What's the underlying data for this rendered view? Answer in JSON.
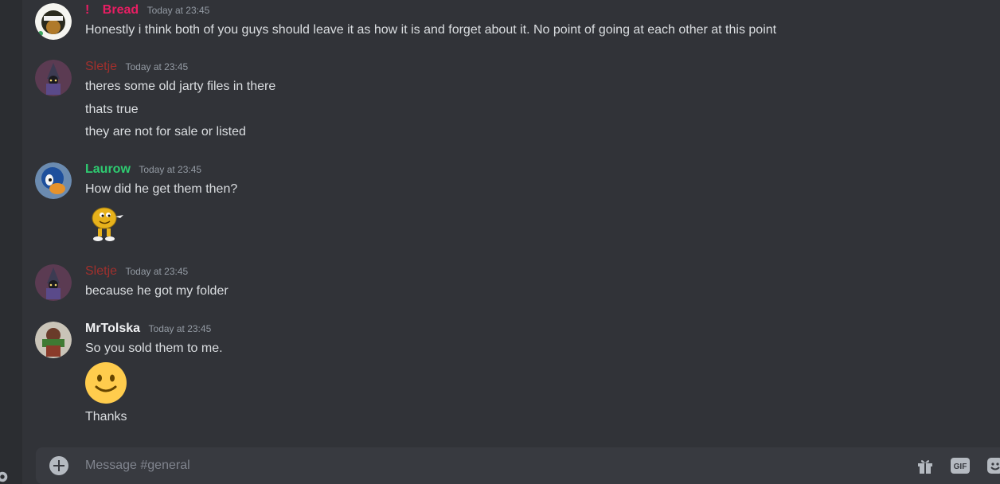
{
  "channel": {
    "message_placeholder": "Message #general"
  },
  "messages": [
    {
      "author_prefix": "!",
      "author": "Bread",
      "author_color": "#e91e63",
      "timestamp": "Today at 23:45",
      "lines": [
        "Honestly i think both of you guys should leave it as how it is and forget about it. No point of going at each other at this point"
      ]
    },
    {
      "author": "Sletje",
      "author_color": "#a0302d",
      "timestamp": "Today at 23:45",
      "lines": [
        "theres some old jarty files in there",
        "thats true",
        "they are not for sale or listed"
      ]
    },
    {
      "author": "Laurow",
      "author_color": "#2ecc71",
      "timestamp": "Today at 23:45",
      "lines": [
        "How did he get them then?"
      ],
      "sticker": "peanut-mascot-sticker"
    },
    {
      "author": "Sletje",
      "author_color": "#a0302d",
      "timestamp": "Today at 23:45",
      "lines": [
        "because he got my folder"
      ]
    },
    {
      "author": "MrTolska",
      "author_color": "#f2f3f5",
      "timestamp": "Today at 23:45",
      "lines": [
        "So you sold them to me.",
        "Thanks"
      ],
      "emoji": "slightly-smiling-face-emoji"
    }
  ],
  "composer_icons": [
    "add-attachment-icon",
    "gift-icon",
    "gif-icon",
    "sticker-icon"
  ]
}
